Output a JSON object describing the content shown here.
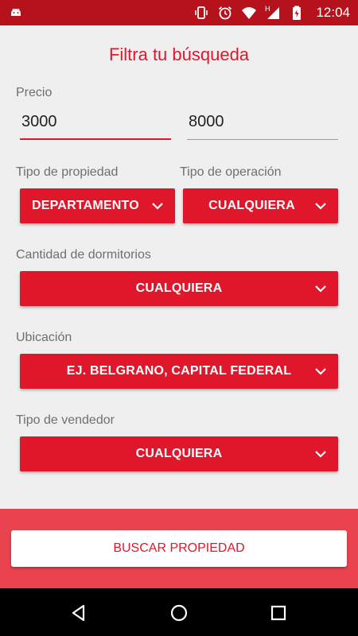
{
  "status_bar": {
    "time": "12:04",
    "network_letter": "H",
    "icons": [
      "android-icon",
      "vibrate-icon",
      "alarm-icon",
      "wifi-icon",
      "signal-icon",
      "battery-icon"
    ]
  },
  "filter": {
    "title": "Filtra tu búsqueda",
    "price": {
      "label": "Precio",
      "min_value": "3000",
      "max_value": "8000"
    },
    "property_type": {
      "label": "Tipo de propiedad",
      "value": "DEPARTAMENTO"
    },
    "operation_type": {
      "label": "Tipo de operación",
      "value": "CUALQUIERA"
    },
    "bedrooms": {
      "label": "Cantidad de dormitorios",
      "value": "CUALQUIERA"
    },
    "location": {
      "label": "Ubicación",
      "value": "EJ. BELGRANO, CAPITAL FEDERAL"
    },
    "seller_type": {
      "label": "Tipo de vendedor",
      "value": "CUALQUIERA"
    },
    "search_button": "BUSCAR PROPIEDAD"
  },
  "colors": {
    "accent": "#e0172b",
    "status_bar": "#b5121b",
    "bottom_panel": "#e8434f",
    "background": "#efefef"
  },
  "nav_bar": {
    "icons": [
      "back-icon",
      "home-icon",
      "recents-icon"
    ]
  }
}
